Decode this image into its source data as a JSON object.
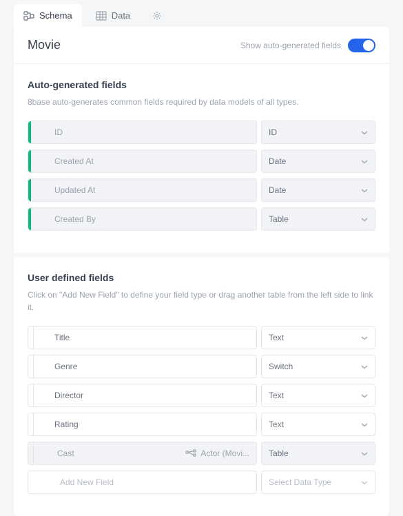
{
  "tabs": {
    "schema": "Schema",
    "data": "Data"
  },
  "header": {
    "title": "Movie",
    "toggle_label": "Show auto-generated fields"
  },
  "auto_section": {
    "title": "Auto-generated fields",
    "desc": "8base auto-generates common fields required by data models of all types.",
    "fields": [
      {
        "name": "ID",
        "type": "ID"
      },
      {
        "name": "Created At",
        "type": "Date"
      },
      {
        "name": "Updated At",
        "type": "Date"
      },
      {
        "name": "Created By",
        "type": "Table"
      }
    ]
  },
  "user_section": {
    "title": "User defined fields",
    "desc": "Click on \"Add New Field\" to define your field type or drag another table from the left side to link it.",
    "fields": [
      {
        "name": "Title",
        "type": "Text"
      },
      {
        "name": "Genre",
        "type": "Switch"
      },
      {
        "name": "Director",
        "type": "Text"
      },
      {
        "name": "Rating",
        "type": "Text"
      },
      {
        "name": "Cast",
        "type": "Table",
        "relation": "Actor (Movi..."
      }
    ],
    "add_placeholder": "Add New Field",
    "add_type_placeholder": "Select Data Type"
  }
}
